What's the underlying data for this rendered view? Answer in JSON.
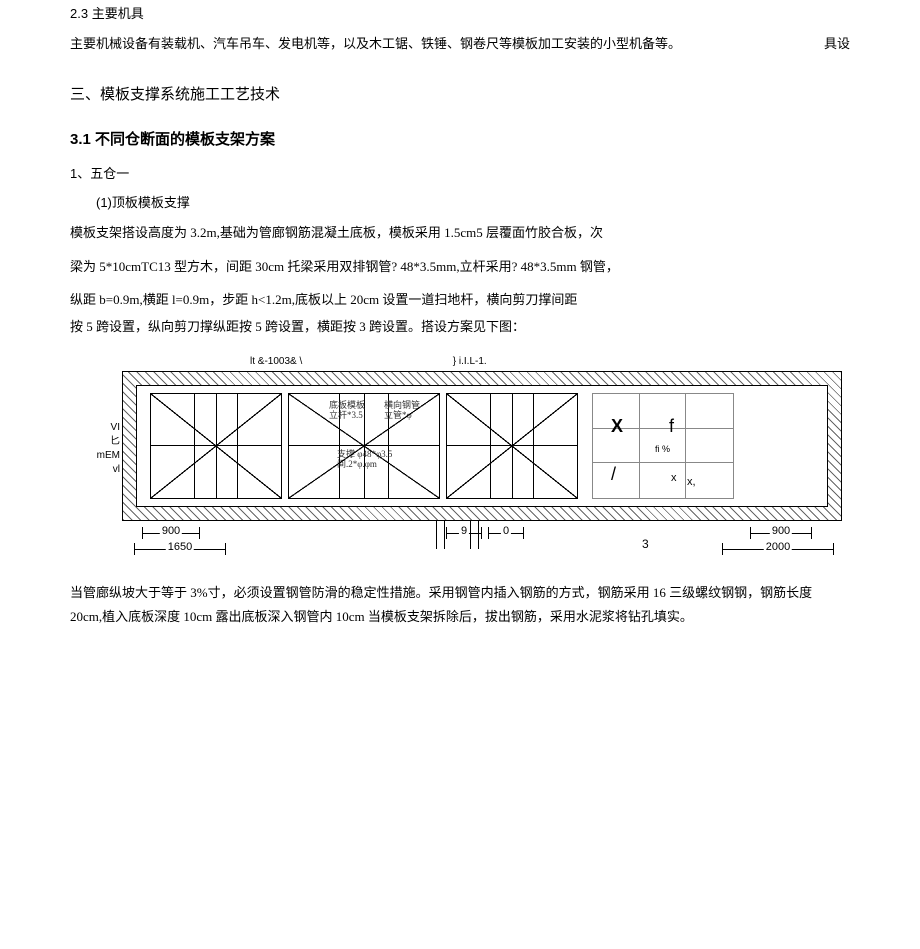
{
  "headings": {
    "h2_3_num": "2.3",
    "h2_3_txt": " 主要机具",
    "h_main": "三、模板支撑系统施工工艺技术",
    "h3_1_num": "3.1",
    "h3_1_txt": " 不同仓断面的模板支架方案",
    "item1_num": "1",
    "item1_txt": "、五仓一",
    "item1_1_num": "(1)",
    "item1_1_txt": "顶板模板支撑"
  },
  "para": {
    "p1_a": "主要机械设备有装载机、汽车吊车、发电机等，以及木工锯、铁锤、钢卷尺等模板加工安装的小型机备等。",
    "p1_float": "具设",
    "b1": "模板支架搭设高度为 3.2m,基础为管廊钢筋混凝土底板，模板采用 1.5cm5 层覆面竹胶合板，次",
    "b2": "梁为 5*10cmTC13 型方木，间距 30cm 托梁采用双排钢管? 48*3.5mm,立杆采用? 48*3.5mm 钢管，",
    "b3": "纵距 b=0.9m,横距 l=0.9m，步距 h<1.2m,底板以上 20cm 设置一道扫地杆，横向剪刀撑间距",
    "b4": "按 5 跨设置，纵向剪刀撑纵距按 5 跨设置，横距按 3 跨设置。搭设方案见下图：",
    "after_a": "当管廊纵坡大于等于 3%寸，必须设置钢管防滑的稳定性措施。采用钢管内插入钢筋的方式，钢筋采用 16 三级螺纹钢钢，钢筋长度",
    "after_b": "20cm,植入底板深度 10cm 露出底板深入钢管内 10cm 当模板支架拆除后，拔出钢筋，采用水泥浆将钻孔填实。"
  },
  "diagram": {
    "top_l": "lt &-1003& \\",
    "top_r": "} i.I.L-1.",
    "left_labels": {
      "a": "VI",
      "b": "匕",
      "c": "mEM",
      "d": "vl"
    },
    "bay2_notes": {
      "a": "底板模板\n立杆*3.5",
      "b": "横向钢管\n立管*φ",
      "c": "支撑 φ48*φ3.5\n间.2*φ.φm"
    },
    "grid_syms": {
      "X": "X",
      "f": "f",
      "fi": "fi     %",
      "slash": "/",
      "x1": "x",
      "x2": "x,"
    },
    "dims": {
      "d900a": "900",
      "d1650": "1650",
      "d9": "9",
      "d0": "0",
      "d3": "3",
      "d900b": "900",
      "d2000": "2000"
    }
  }
}
